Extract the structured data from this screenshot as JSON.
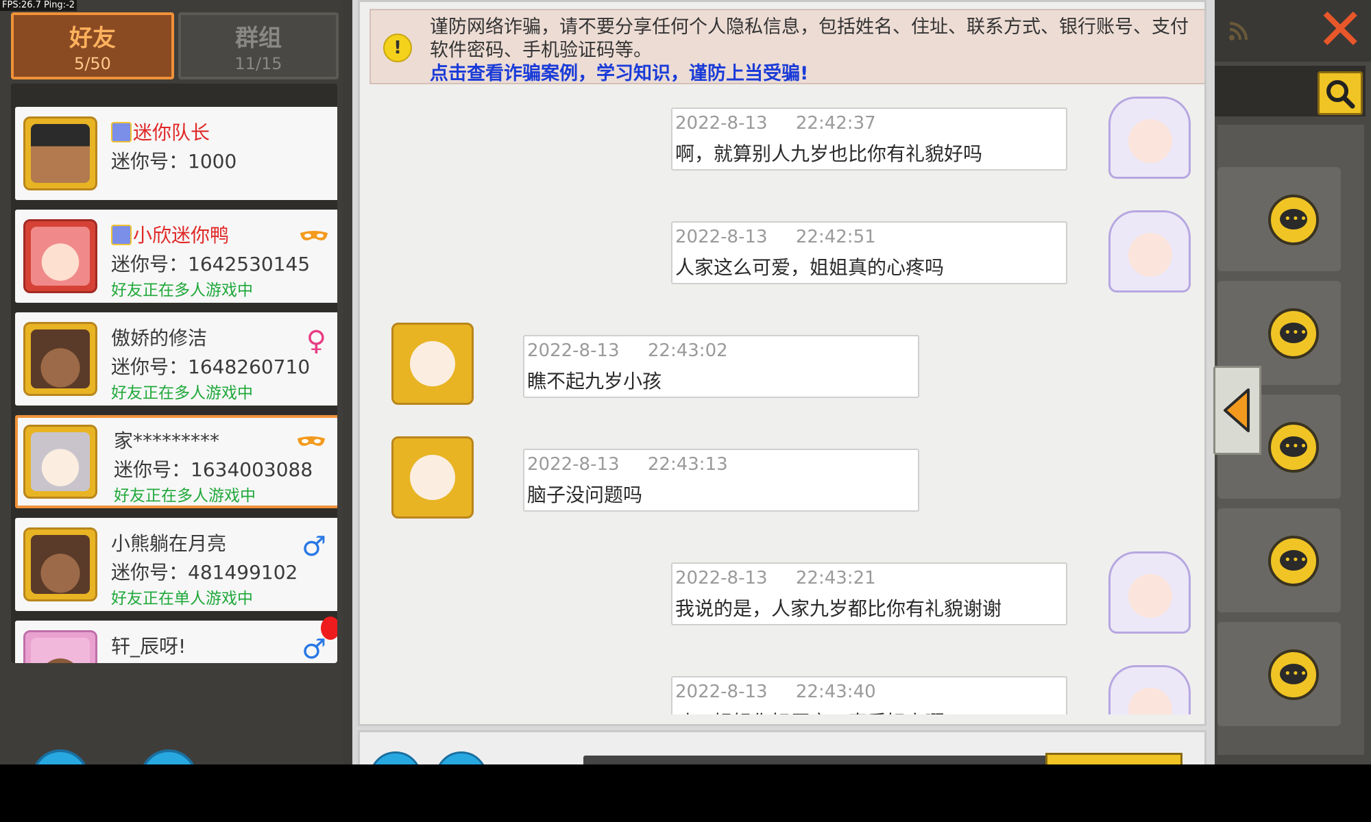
{
  "debug": {
    "fps_text": "FPS:26.7  Ping:-2"
  },
  "tabs": [
    {
      "label": "好友",
      "count": "5/50"
    },
    {
      "label": "群组",
      "count": "11/15"
    }
  ],
  "friends": [
    {
      "name": "迷你队长",
      "id_label": "迷你号：1000",
      "status": "",
      "vip": true
    },
    {
      "name": "小欣迷你鸭",
      "id_label": "迷你号：1642530145",
      "status": "好友正在多人游戏中",
      "vip": true
    },
    {
      "name": "傲娇的修洁",
      "id_label": "迷你号：1648260710",
      "status": "好友正在多人游戏中",
      "vip": false
    },
    {
      "name": "家*********",
      "id_label": "迷你号：1634003088",
      "status": "好友正在多人游戏中",
      "vip": false
    },
    {
      "name": "小熊躺在月亮",
      "id_label": "迷你号：481499102",
      "status": "好友正在单人游戏中",
      "vip": false
    },
    {
      "name": "轩_辰呀!",
      "id_label": "",
      "status": "",
      "vip": false
    }
  ],
  "warning": {
    "text": "谨防网络诈骗，请不要分享任何个人隐私信息，包括姓名、住址、联系方式、银行账号、支付软件密码、手机验证码等。",
    "link": "点击查看诈骗案例，学习知识，谨防上当受骗!"
  },
  "messages": [
    {
      "side": "mine",
      "timestamp": "2022-8-13     22:42:37",
      "text": "啊，就算别人九岁也比你有礼貌好吗"
    },
    {
      "side": "mine",
      "timestamp": "2022-8-13     22:42:51",
      "text": "人家这么可爱，姐姐真的心疼吗"
    },
    {
      "side": "other",
      "timestamp": "2022-8-13     22:43:02",
      "text": "瞧不起九岁小孩"
    },
    {
      "side": "other",
      "timestamp": "2022-8-13     22:43:13",
      "text": "脑子没问题吗"
    },
    {
      "side": "mine",
      "timestamp": "2022-8-13     22:43:21",
      "text": "我说的是，人家九岁都比你有礼貌谢谢"
    },
    {
      "side": "mine",
      "timestamp": "2022-8-13     22:43:40",
      "text": "哇，姐姐你好厉害，真质好高啊"
    }
  ],
  "icons": {
    "close": "close-icon",
    "search": "search-icon",
    "rss": "rss-icon",
    "chat": "chat-bubble-icon",
    "collapse": "triangle-left-icon",
    "male": "♂",
    "female": "♀",
    "alert": "!"
  },
  "colors": {
    "accent": "#f0923a",
    "vip_name": "#e02828",
    "status_green": "#1fa83a",
    "link_blue": "#1a3bd8"
  }
}
